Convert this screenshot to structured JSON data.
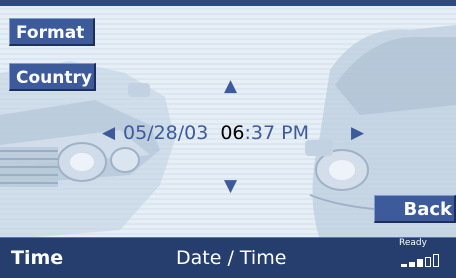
{
  "side_buttons": {
    "format_label": "Format",
    "country_label": "Country",
    "back_label": "Back"
  },
  "clock": {
    "date": "05/28/03",
    "hour": "06",
    "minutes_ampm": ":37 PM"
  },
  "footer": {
    "left_label": "Time",
    "center_label": "Date / Time",
    "status_label": "Ready"
  },
  "signal": {
    "filled_bars": 3,
    "total_bars": 5
  },
  "colors": {
    "accent": "#3d5a9a",
    "bar": "#263e6e",
    "background": "#e6eef6"
  }
}
